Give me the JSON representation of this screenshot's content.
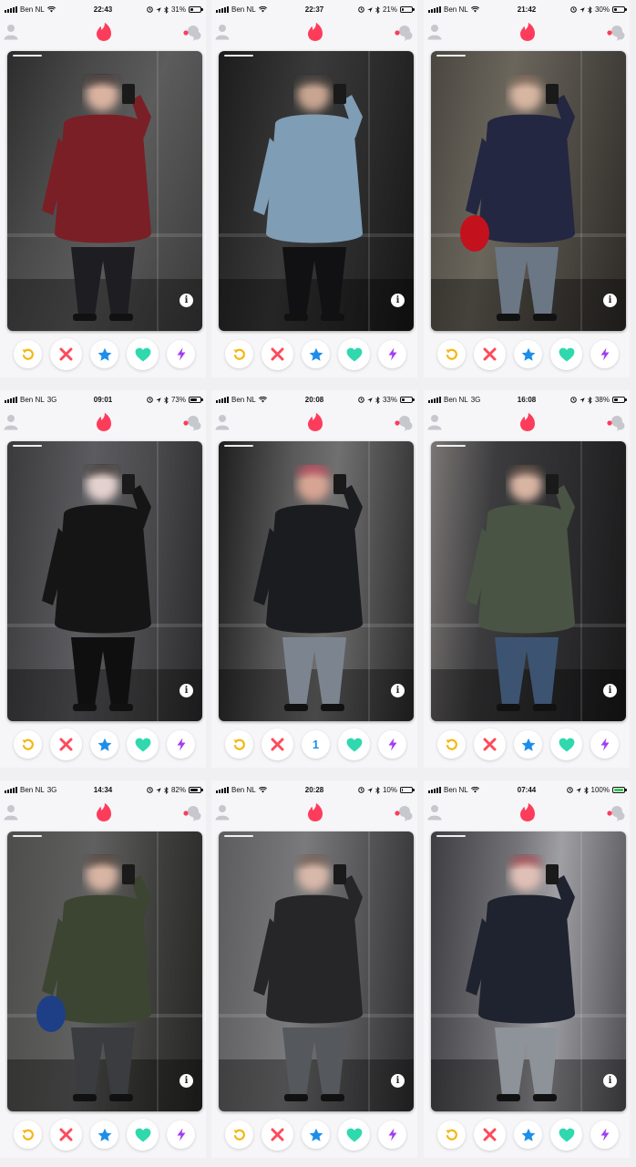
{
  "app": {
    "name": "Tinder"
  },
  "colors": {
    "flame": "#fd3c5c",
    "rewind": "#f5b70f",
    "nope": "#fd4a5c",
    "super_like": "#1c8eea",
    "like": "#2fd8ad",
    "boost": "#a23cf0",
    "notification_dot": "#fd3c5c"
  },
  "icons": {
    "profile": "person-icon",
    "logo": "tinder-flame-icon",
    "messages": "chat-bubbles-icon",
    "rewind": "rewind-arrow-icon",
    "nope": "x-icon",
    "super_like": "star-icon",
    "like": "heart-icon",
    "boost": "lightning-bolt-icon",
    "info": "info-icon"
  },
  "screens": [
    {
      "carrier": "Ben NL",
      "network": "wifi",
      "time": "22:43",
      "battery_text": "31%",
      "battery_level": 0.31,
      "boost_label": "",
      "photo": "Man in red puffer jacket taking mirror selfie in elevator"
    },
    {
      "carrier": "Ben NL",
      "network": "wifi",
      "time": "22:37",
      "battery_text": "21%",
      "battery_level": 0.21,
      "boost_label": "",
      "photo": "Man in denim jacket and cap taking mirror selfie in elevator"
    },
    {
      "carrier": "Ben NL",
      "network": "wifi",
      "time": "21:42",
      "battery_text": "30%",
      "battery_level": 0.3,
      "boost_label": "",
      "photo": "Man in navy puffer jacket holding red bag in elevator"
    },
    {
      "carrier": "Ben NL",
      "network": "3G",
      "time": "09:01",
      "battery_text": "73%",
      "battery_level": 0.73,
      "boost_label": "",
      "photo": "Man in black leather jacket taking mirror selfie in elevator"
    },
    {
      "carrier": "Ben NL",
      "network": "wifi",
      "time": "20:08",
      "battery_text": "33%",
      "battery_level": 0.33,
      "boost_label": "1",
      "photo": "Man in black parka and cap taking mirror selfie in elevator"
    },
    {
      "carrier": "Ben NL",
      "network": "3G",
      "time": "16:08",
      "battery_text": "38%",
      "battery_level": 0.38,
      "boost_label": "",
      "photo": "Man in olive bomber jacket taking mirror selfie in elevator"
    },
    {
      "carrier": "Ben NL",
      "network": "3G",
      "time": "14:34",
      "battery_text": "82%",
      "battery_level": 0.82,
      "boost_label": "",
      "photo": "Man in green bomber jacket holding blue bag in elevator"
    },
    {
      "carrier": "Ben NL",
      "network": "wifi",
      "time": "20:28",
      "battery_text": "10%",
      "battery_level": 0.1,
      "boost_label": "",
      "photo": "Man in dark quilted jacket taking mirror selfie in elevator"
    },
    {
      "carrier": "Ben NL",
      "network": "wifi",
      "time": "07:44",
      "battery_text": "100%",
      "battery_level": 1.0,
      "boost_label": "",
      "photo": "Man in dark parka taking mirror selfie in elevator"
    }
  ]
}
